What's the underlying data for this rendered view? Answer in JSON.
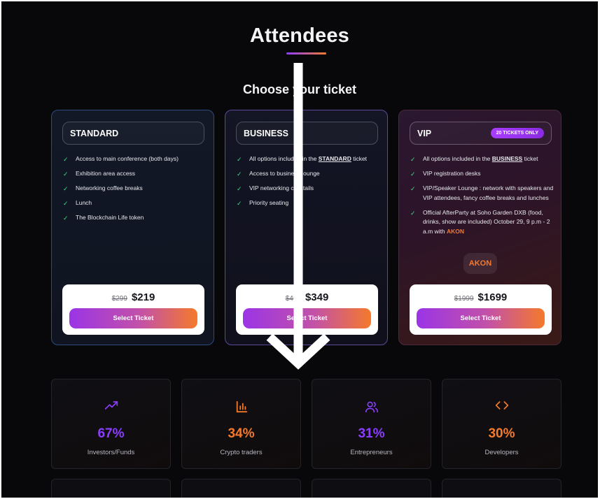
{
  "page": {
    "title": "Attendees",
    "subtitle": "Choose your ticket"
  },
  "colors": {
    "accent_purple": "#8b3dff",
    "accent_orange": "#f47a2c",
    "check_green": "#3ddc84"
  },
  "tickets": [
    {
      "name": "STANDARD",
      "features": [
        "Access to main conference (both days)",
        "Exhibition area access",
        "Networking coffee breaks",
        "Lunch",
        "The Blockchain Life token"
      ],
      "old_price": "$299",
      "price": "$219",
      "button_label": "Select Ticket"
    },
    {
      "name": "BUSINESS",
      "features": [
        {
          "before": "All options included in the ",
          "ref": "STANDARD",
          "after": " ticket"
        },
        "Access to business lounge",
        "VIP networking cocktails",
        "Priority seating"
      ],
      "old_price": "$499",
      "price": "$349",
      "button_label": "Select Ticket"
    },
    {
      "name": "VIP",
      "badge": "20 TICKETS ONLY",
      "features": [
        {
          "before": "All options included in the ",
          "ref": "BUSINESS",
          "after": " ticket"
        },
        "VIP registration desks",
        "VIP/Speaker Lounge : network with speakers and VIP attendees, fancy coffee breaks and lunches",
        {
          "before": "Official AfterParty at Soho Garden DXB (food, drinks, show are included) October 29, 9 p.m - 2 a.m with ",
          "hl": "AKON"
        }
      ],
      "chip": "AKON",
      "old_price": "$1999",
      "price": "$1699",
      "button_label": "Select Ticket"
    }
  ],
  "stats": [
    {
      "icon": "trending-up-icon",
      "value": "67%",
      "label": "Investors/Funds",
      "color": "#8b3dff"
    },
    {
      "icon": "bar-chart-icon",
      "value": "34%",
      "label": "Crypto traders",
      "color": "#f47a2c"
    },
    {
      "icon": "users-icon",
      "value": "31%",
      "label": "Entrepreneurs",
      "color": "#8b3dff"
    },
    {
      "icon": "code-icon",
      "value": "30%",
      "label": "Developers",
      "color": "#f47a2c"
    }
  ]
}
